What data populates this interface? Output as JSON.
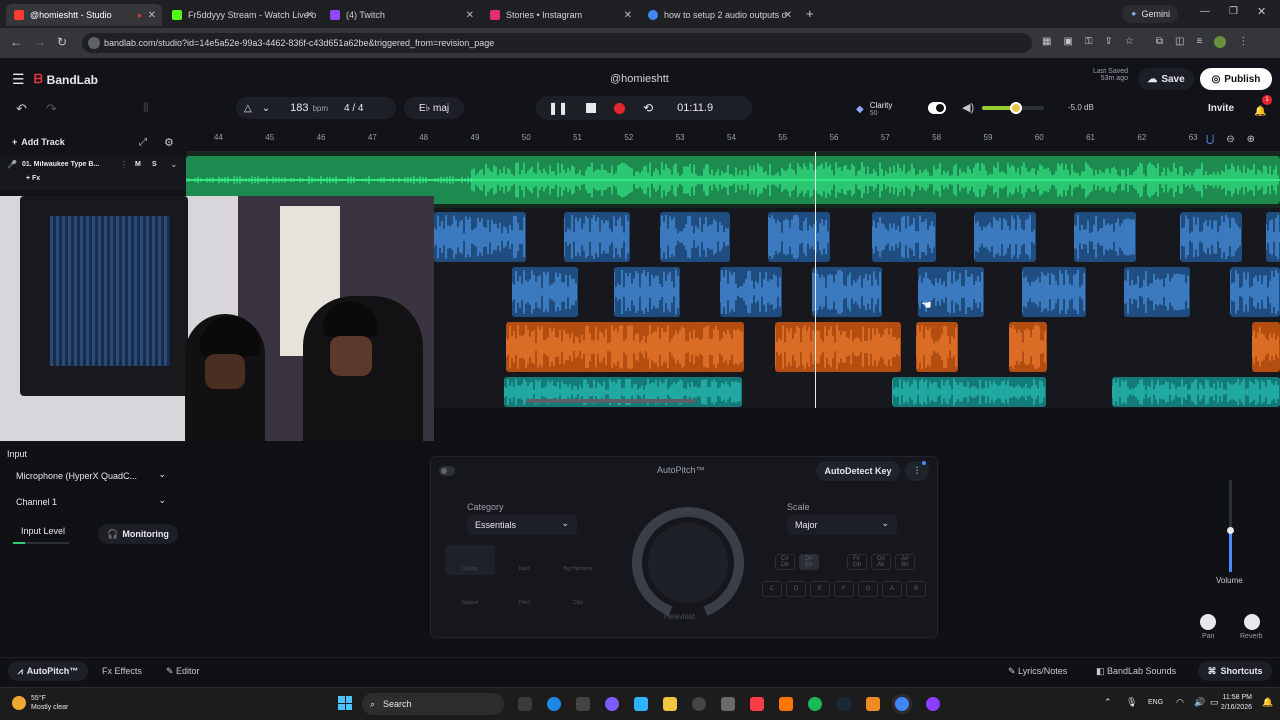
{
  "browser": {
    "tabs": [
      {
        "label": "@homieshtt - Studio",
        "active": true,
        "color": "#ff3b30"
      },
      {
        "label": "Fr5ddyyy Stream - Watch Live o",
        "active": false,
        "color": "#53fc18"
      },
      {
        "label": "(4) Twitch",
        "active": false,
        "color": "#9146ff"
      },
      {
        "label": "Stories • Instagram",
        "active": false,
        "color": "#e1306c"
      },
      {
        "label": "how to setup 2 audio outputs o",
        "active": false,
        "color": "#4285f4"
      }
    ],
    "gemini_label": "Gemini",
    "url": "bandlab.com/studio?id=14e5a52e-99a3-4462-836f-c43d651a62be&triggered_from=revision_page"
  },
  "app": {
    "logo": "BandLab",
    "project_title": "@homieshtt",
    "last_saved_label": "Last Saved",
    "last_saved_time": "53m ago",
    "save_label": "Save",
    "publish_label": "Publish",
    "invite_label": "Invite",
    "notification_count": "1",
    "bpm_value": "183",
    "bpm_unit": "bpm",
    "time_signature": "4 / 4",
    "key": "E♭ maj",
    "time_display": "01:11.9",
    "clarity_label": "Clarity",
    "clarity_value": "50",
    "master_volume": "-5.0 dB",
    "master_volume_level": 0.55
  },
  "tracks": {
    "add_track_label": "Add Track",
    "track1_name": "01. Milwaukee Type B...",
    "track1_fx": "+ Fx",
    "mute_label": "M",
    "solo_label": "S"
  },
  "ruler": [
    "44",
    "45",
    "46",
    "47",
    "48",
    "49",
    "50",
    "51",
    "52",
    "53",
    "54",
    "55",
    "56",
    "57",
    "58",
    "59",
    "60",
    "61",
    "62",
    "63"
  ],
  "input_panel": {
    "title": "Input",
    "device": "Microphone (HyperX QuadC...",
    "channel": "Channel 1",
    "input_level_label": "Input Level",
    "input_level": 0.22,
    "monitoring_label": "Monitoring"
  },
  "autopitch": {
    "title": "AutoPitch™",
    "autodetect_label": "AutoDetect Key",
    "category_label": "Category",
    "category_value": "Essentials",
    "scale_label": "Scale",
    "scale_value": "Major",
    "styles": [
      "Classic",
      "Duet",
      "Big Harmony",
      "Natural",
      "Third",
      "Chip"
    ],
    "knob_label": "Heaviest",
    "sharp_keys": [
      "C#\nDb",
      "D#\nEb",
      "F#\nGb",
      "G#\nAb",
      "A#\nBb"
    ],
    "natural_keys": [
      "C",
      "D",
      "E",
      "F",
      "G",
      "A",
      "B"
    ]
  },
  "mixer": {
    "volume_label": "Volume",
    "volume_level": 0.45,
    "pan_label": "Pan",
    "reverb_label": "Reverb"
  },
  "bottombar": {
    "autopitch_tab": "AutoPitch™",
    "effects_tab": "Effects",
    "editor_tab": "Editor",
    "lyrics_label": "Lyrics/Notes",
    "sounds_label": "BandLab Sounds",
    "shortcuts_label": "Shortcuts"
  },
  "taskbar": {
    "temperature": "55°F",
    "weather": "Mostly clear",
    "search_label": "Search",
    "language": "ENG",
    "time": "11:58 PM",
    "date": "2/16/2026"
  }
}
